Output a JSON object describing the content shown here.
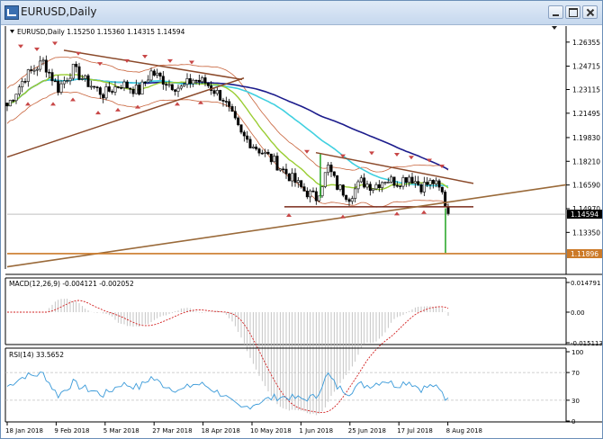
{
  "window": {
    "title": "EURUSD,Daily"
  },
  "main_chart": {
    "header": "EURUSD,Daily  1.15250 1.15360 1.14315 1.14594",
    "price_ticks": [
      "1.26355",
      "1.24715",
      "1.23115",
      "1.21495",
      "1.19830",
      "1.18210",
      "1.16590",
      "1.14970",
      "1.13350"
    ],
    "current_price": "1.14594",
    "level_price": "1.11896",
    "price_range": [
      1.1085,
      1.2745
    ]
  },
  "macd": {
    "header": "MACD(12,26,9) -0.004121 -0.002052",
    "ticks": [
      "0.014791",
      "0.00",
      "-0.015113"
    ]
  },
  "rsi": {
    "header": "RSI(14) 33.5652",
    "ticks": [
      "100",
      "70",
      "30",
      "0"
    ]
  },
  "time_axis": [
    "18 Jan 2018",
    "9 Feb 2018",
    "5 Mar 2018",
    "27 Mar 2018",
    "18 Apr 2018",
    "10 May 2018",
    "1 Jun 2018",
    "25 Jun 2018",
    "17 Jul 2018",
    "8 Aug 2018"
  ],
  "colors": {
    "ma_long": "#1c1c8c",
    "ma_mid": "#40d0e0",
    "ma_short": "#9acd32",
    "bollinger": "#c8643c",
    "trendline": "#8b4a2b",
    "fractal": "#c84646",
    "macd_signal": "#d22020",
    "rsi_line": "#3a9ad9",
    "marker_green": "#2ea82e",
    "level_line": "#cc7a28",
    "price_label_bg": "#000000"
  }
}
